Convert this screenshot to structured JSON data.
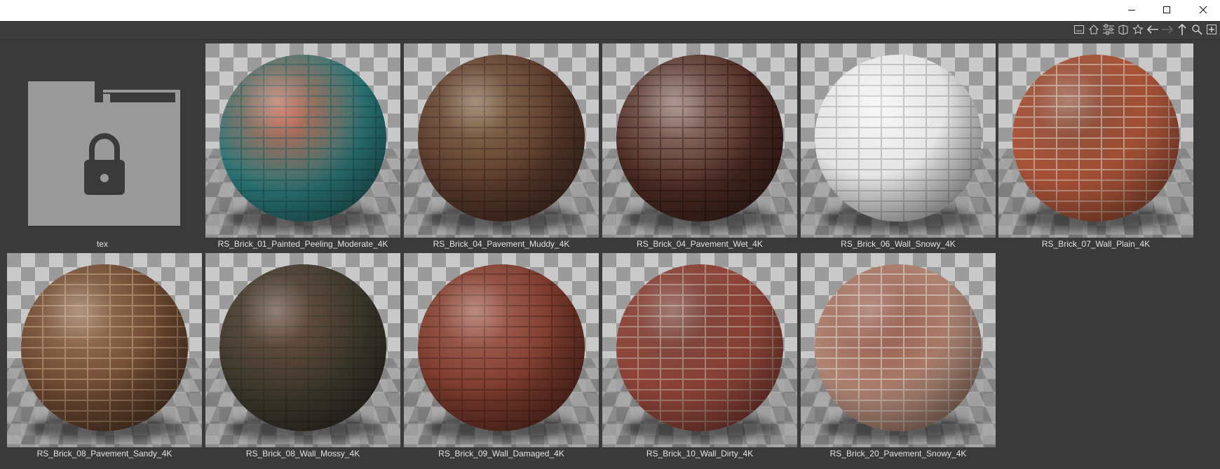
{
  "window": {
    "controls": [
      "minimize",
      "maximize",
      "close"
    ]
  },
  "toolbar": {
    "icons": [
      "panel-icon",
      "home-icon",
      "filter-icon",
      "book-icon",
      "star-icon",
      "back-arrow-icon",
      "forward-arrow-icon",
      "up-arrow-icon",
      "search-icon",
      "add-icon"
    ]
  },
  "items": [
    {
      "label": "tex",
      "type": "folder"
    },
    {
      "label": "RS_Brick_01_Painted_Peeling_Moderate_4K",
      "type": "material",
      "base": "#2c7a7c",
      "mortar": "#1d5556",
      "accent": "#c2583d"
    },
    {
      "label": "RS_Brick_04_Pavement_Muddy_4K",
      "type": "material",
      "base": "#5a3a2c",
      "mortar": "#3a261c",
      "accent": "#7a5a3a"
    },
    {
      "label": "RS_Brick_04_Pavement_Wet_4K",
      "type": "material",
      "base": "#4c2a22",
      "mortar": "#2a1712",
      "accent": "#8a6a60"
    },
    {
      "label": "RS_Brick_06_Wall_Snowy_4K",
      "type": "material",
      "base": "#e1e1e1",
      "mortar": "#9d9d9d",
      "accent": "#f4f4f4"
    },
    {
      "label": "RS_Brick_07_Wall_Plain_4K",
      "type": "material",
      "base": "#b0563a",
      "mortar": "#d9cfc2",
      "accent": "#7a3a25"
    },
    {
      "label": "RS_Brick_08_Pavement_Sandy_4K",
      "type": "material",
      "base": "#6a4630",
      "mortar": "#c2a67e",
      "accent": "#8a6040"
    },
    {
      "label": "RS_Brick_08_Wall_Mossy_4K",
      "type": "material",
      "base": "#3d3a2e",
      "mortar": "#2a2f22",
      "accent": "#5a3a2a"
    },
    {
      "label": "RS_Brick_09_Wall_Damaged_4K",
      "type": "material",
      "base": "#7a3a2c",
      "mortar": "#4e241c",
      "accent": "#9a5040"
    },
    {
      "label": "RS_Brick_10_Wall_Dirty_4K",
      "type": "material",
      "base": "#94463a",
      "mortar": "#bdb2a4",
      "accent": "#6a3026"
    },
    {
      "label": "RS_Brick_20_Pavement_Snowy_4K",
      "type": "material",
      "base": "#b48a78",
      "mortar": "#dedad6",
      "accent": "#8a4a3a"
    }
  ]
}
